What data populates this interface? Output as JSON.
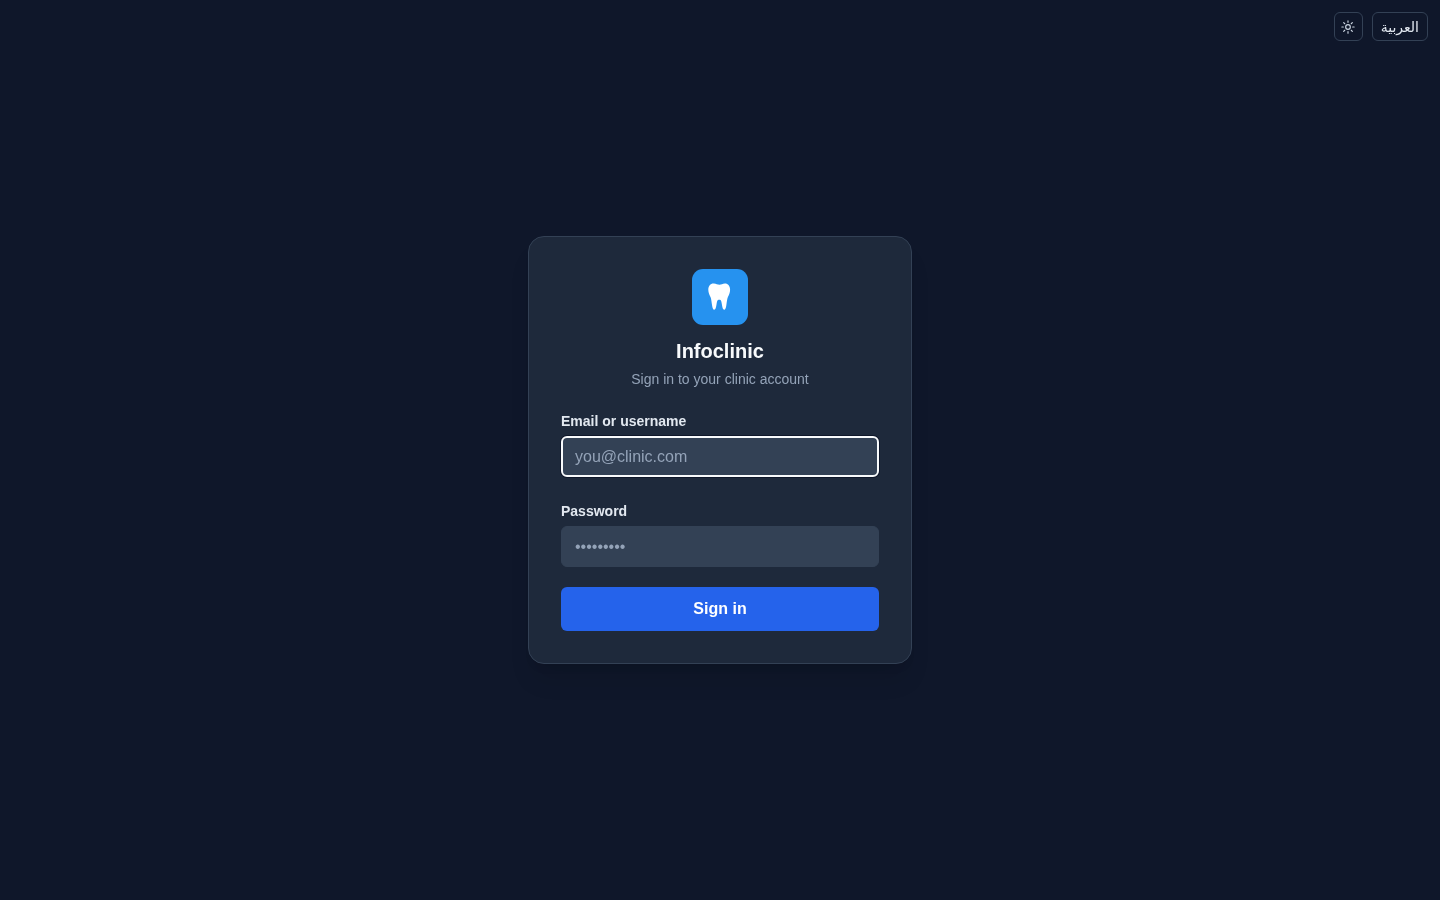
{
  "top_bar": {
    "language_button": {
      "label": "العربية"
    }
  },
  "brand": {
    "name": "Infoclinic",
    "subtitle": "Sign in to your clinic account"
  },
  "form": {
    "fields": [
      {
        "label": "Email or username",
        "placeholder": "you@clinic.com",
        "focused": true
      },
      {
        "label": "Password",
        "placeholder": "•••••••••",
        "focused": false
      }
    ],
    "submit": {
      "label": "Sign in"
    }
  }
}
